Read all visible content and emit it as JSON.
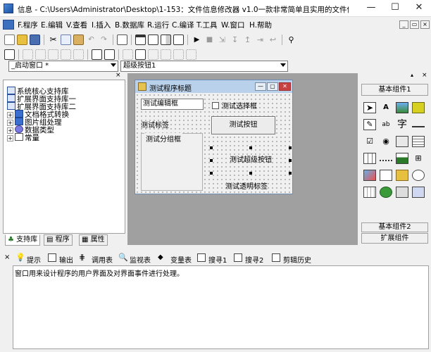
{
  "window": {
    "title": "信息 - C:\\Users\\Administrator\\Desktop\\1-153：文件信息修改器 v1.0一款非常简单且实用的文件信息修改软...",
    "controls": {
      "minimize": "—",
      "maximize": "☐",
      "close": "✕"
    }
  },
  "menu": [
    {
      "label": "F.程序"
    },
    {
      "label": "E.编辑"
    },
    {
      "label": "V.查看"
    },
    {
      "label": "I.插入"
    },
    {
      "label": "B.数据库"
    },
    {
      "label": "R.运行"
    },
    {
      "label": "C.编译"
    },
    {
      "label": "T.工具"
    },
    {
      "label": "W.窗口"
    },
    {
      "label": "H.帮助"
    }
  ],
  "mdi_controls": {
    "minimize": "_",
    "restore": "▭",
    "close": "×"
  },
  "selectors": {
    "window_combo": "_启动窗口 *",
    "control_combo": "超级按钮1"
  },
  "left_panel": {
    "tree": [
      {
        "label": "系统核心支持库",
        "expander": ""
      },
      {
        "label": "扩展界面支持库一",
        "expander": ""
      },
      {
        "label": "扩展界面支持库二",
        "expander": ""
      },
      {
        "label": "文档格式转换",
        "expander": "+"
      },
      {
        "label": "图片组处理",
        "expander": "+"
      },
      {
        "label": "数据类型",
        "expander": "+"
      },
      {
        "label": "常量",
        "expander": "+"
      }
    ],
    "tabs": [
      {
        "label": "支持库"
      },
      {
        "label": "程序"
      },
      {
        "label": "属性"
      }
    ]
  },
  "designer": {
    "form_title": "测试程序标题",
    "edit_value": "测试编辑框",
    "checkbox_label": "测试选择框",
    "label_text": "测试标签",
    "button_text": "测试按钮",
    "group_text": "测试分组框",
    "super_button_text": "测试超级按钮",
    "transparent_label": "测试透明标签"
  },
  "right_panel": {
    "header_basic": "基本组件1",
    "footer_basic2": "基本组件2",
    "footer_ext": "扩展组件",
    "icons": [
      "pointer-icon",
      "label-icon",
      "picture-icon",
      "shape-icon",
      "edit-icon",
      "textbox-icon",
      "font-icon",
      "line-icon",
      "checkbox-icon",
      "radio-icon",
      "button-icon",
      "list-icon",
      "table-icon",
      "ruler-icon",
      "scroll-icon",
      "tree-icon",
      "image-icon",
      "combo-icon",
      "folder-icon",
      "timer-icon",
      "calendar-icon",
      "network-icon",
      "printer-icon",
      "db-icon"
    ]
  },
  "bottom_tabs": [
    {
      "label": "提示",
      "icon": "lightbulb-icon"
    },
    {
      "label": "输出",
      "icon": "output-icon"
    },
    {
      "label": "调用表",
      "icon": "callstack-icon"
    },
    {
      "label": "监视表",
      "icon": "watch-icon"
    },
    {
      "label": "变量表",
      "icon": "variables-icon"
    },
    {
      "label": "搜寻1",
      "icon": "search1-icon"
    },
    {
      "label": "搜寻2",
      "icon": "search2-icon"
    },
    {
      "label": "剪辑历史",
      "icon": "clip-history-icon"
    }
  ],
  "output_text": "窗口用来设计程序的用户界面及对界面事件进行处理。",
  "colors": {
    "accent": "#0a246a",
    "form_title_bar": "#b9d1ea",
    "selection": "#000000"
  }
}
